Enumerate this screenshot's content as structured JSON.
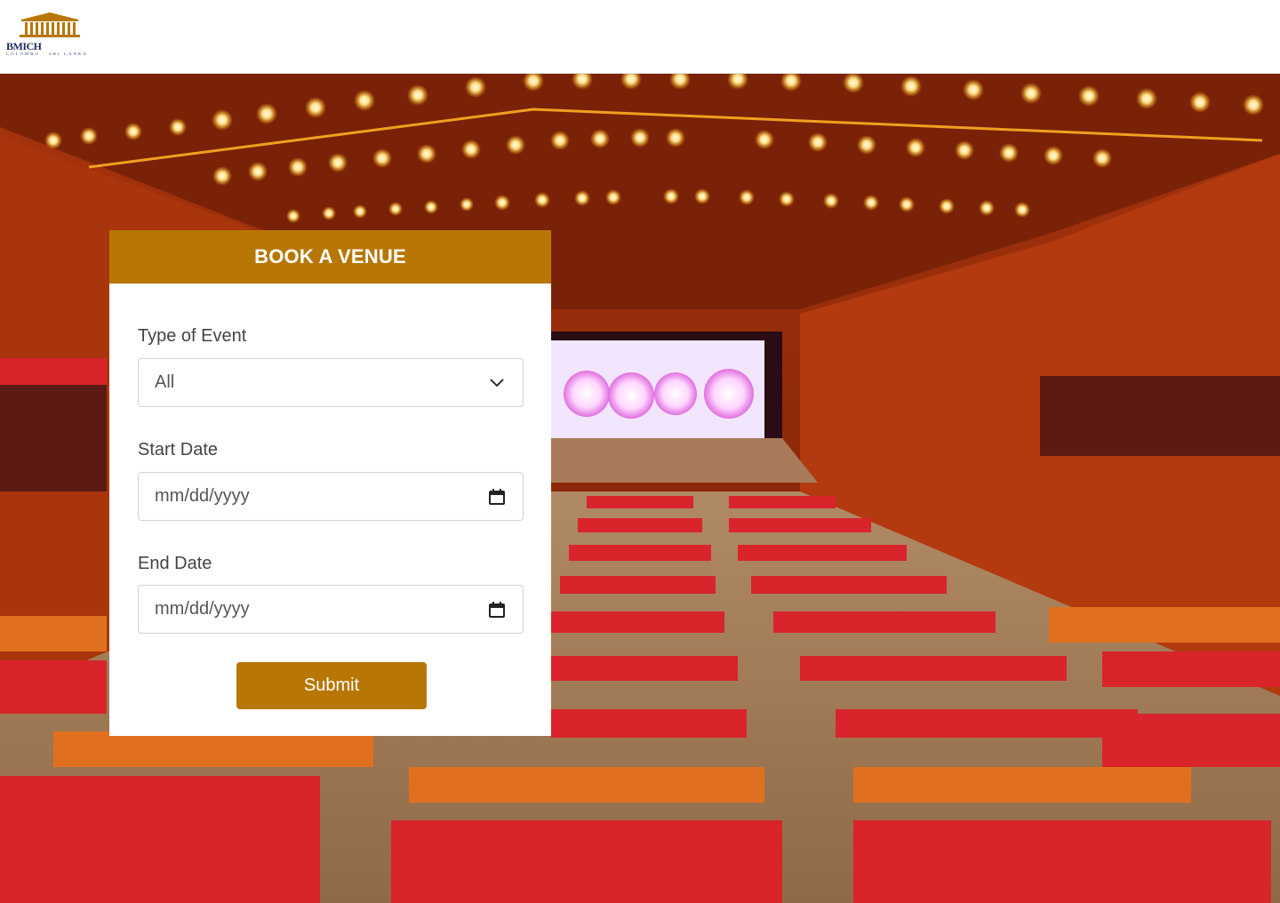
{
  "header": {
    "logo_text": "BMICH",
    "logo_subtext": "COLOMBO · SRI LANKA"
  },
  "booking": {
    "title": "BOOK A VENUE",
    "event_type_label": "Type of Event",
    "event_type_value": "All",
    "start_date_label": "Start Date",
    "start_date_placeholder": "mm/dd/yyyy",
    "end_date_label": "End Date",
    "end_date_placeholder": "mm/dd/yyyy",
    "submit_label": "Submit"
  },
  "colors": {
    "accent": "#b87705",
    "header_bg": "#ffffff"
  },
  "icons": {
    "dropdown": "chevron-down-icon",
    "calendar": "calendar-icon"
  }
}
